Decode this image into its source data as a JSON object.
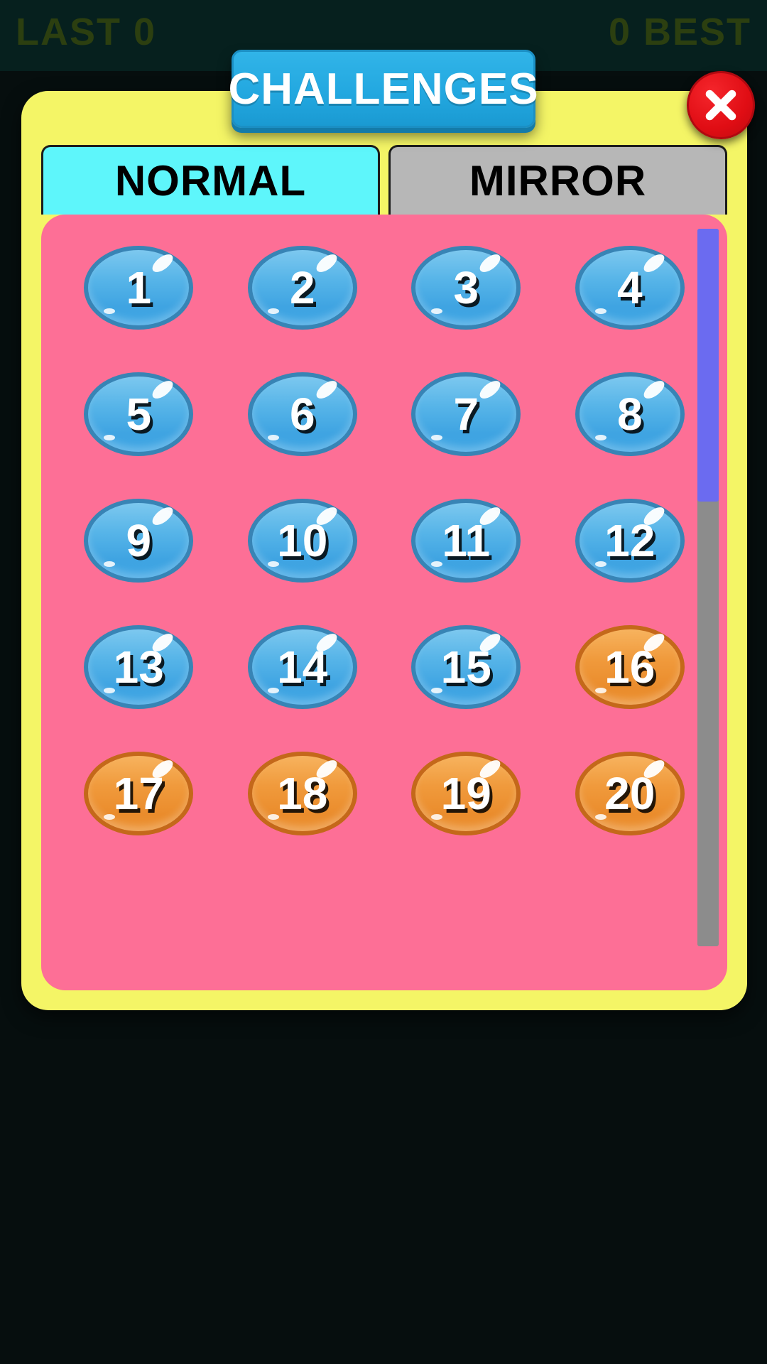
{
  "hud": {
    "last_label": "LAST 0",
    "best_label": "0 BEST"
  },
  "dialog": {
    "title": "CHALLENGES",
    "close_icon": "close-x-icon",
    "tabs": [
      {
        "label": "NORMAL",
        "state": "active"
      },
      {
        "label": "MIRROR",
        "state": "inactive"
      }
    ],
    "levels": [
      {
        "num": "1",
        "state": "blue"
      },
      {
        "num": "2",
        "state": "blue"
      },
      {
        "num": "3",
        "state": "blue"
      },
      {
        "num": "4",
        "state": "blue"
      },
      {
        "num": "5",
        "state": "blue"
      },
      {
        "num": "6",
        "state": "blue"
      },
      {
        "num": "7",
        "state": "blue"
      },
      {
        "num": "8",
        "state": "blue"
      },
      {
        "num": "9",
        "state": "blue"
      },
      {
        "num": "10",
        "state": "blue"
      },
      {
        "num": "11",
        "state": "blue"
      },
      {
        "num": "12",
        "state": "blue"
      },
      {
        "num": "13",
        "state": "blue"
      },
      {
        "num": "14",
        "state": "blue"
      },
      {
        "num": "15",
        "state": "blue"
      },
      {
        "num": "16",
        "state": "orange"
      },
      {
        "num": "17",
        "state": "orange"
      },
      {
        "num": "18",
        "state": "orange"
      },
      {
        "num": "19",
        "state": "orange"
      },
      {
        "num": "20",
        "state": "orange"
      }
    ],
    "scrollbar": {
      "thumb_position_pct": 0,
      "thumb_size_pct": 38
    }
  },
  "colors": {
    "panel_yellow": "#f4f566",
    "content_pink": "#fd6f96",
    "tab_active": "#5ef6fb",
    "tab_inactive": "#b7b7b7",
    "title_blue": "#23a8e0",
    "close_red": "#e00d14",
    "level_blue": "#3fa4e2",
    "level_orange": "#ea8c2c",
    "scroll_thumb": "#6b6bf0",
    "scroll_track": "#8c8c8c",
    "background": "#0a1414"
  }
}
